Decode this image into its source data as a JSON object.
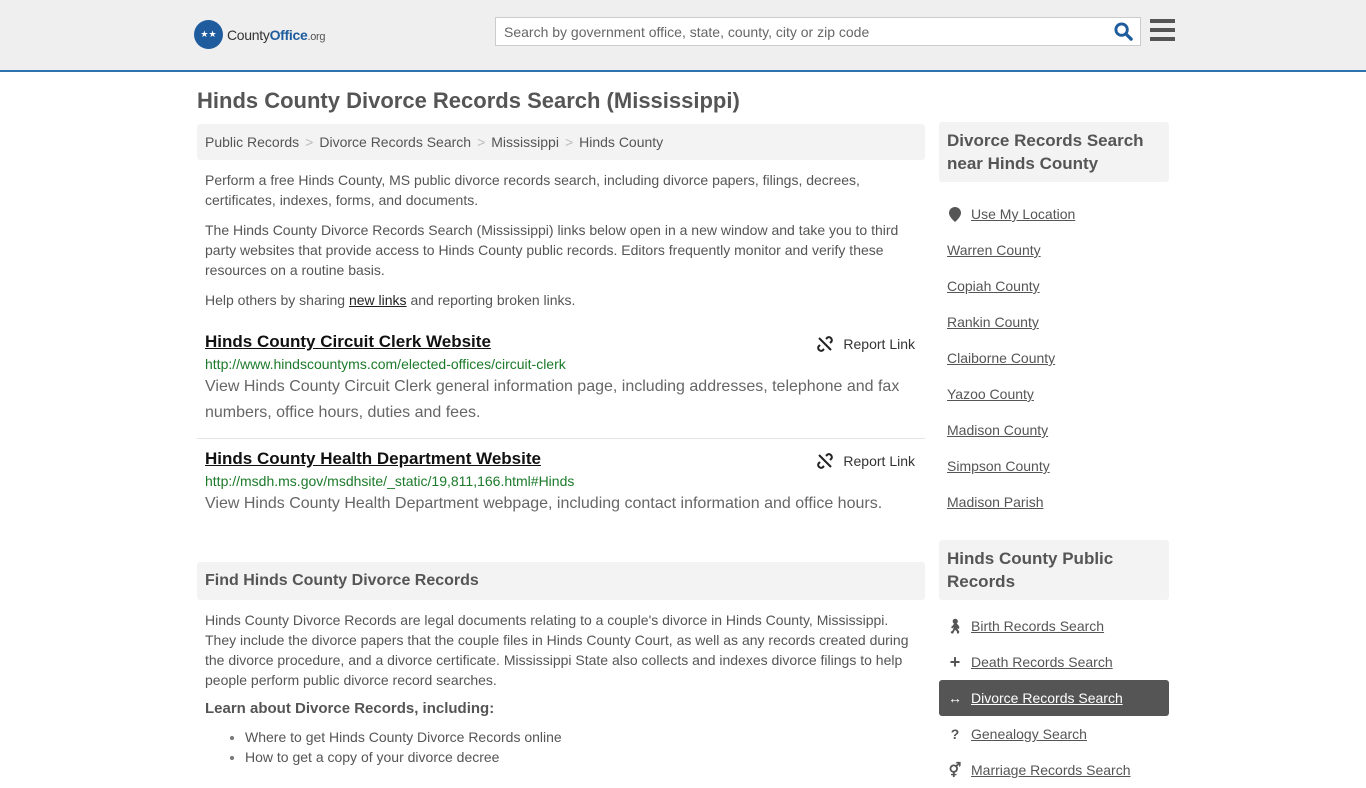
{
  "header": {
    "logo_text_main": "County",
    "logo_text_brand": "Office",
    "logo_text_tld": ".org",
    "search_placeholder": "Search by government office, state, county, city or zip code",
    "search_value": ""
  },
  "page_title": "Hinds County Divorce Records Search (Mississippi)",
  "breadcrumb": [
    "Public Records",
    "Divorce Records Search",
    "Mississippi",
    "Hinds County"
  ],
  "intro": {
    "p1": "Perform a free Hinds County, MS public divorce records search, including divorce papers, filings, decrees, certificates, indexes, forms, and documents.",
    "p2": "The Hinds County Divorce Records Search (Mississippi) links below open in a new window and take you to third party websites that provide access to Hinds County public records. Editors frequently monitor and verify these resources on a routine basis.",
    "p3_before": "Help others by sharing ",
    "p3_link": "new links",
    "p3_after": " and reporting broken links."
  },
  "links": [
    {
      "title": "Hinds County Circuit Clerk Website",
      "url": "http://www.hindscountyms.com/elected-offices/circuit-clerk",
      "description": "View Hinds County Circuit Clerk general information page, including addresses, telephone and fax numbers, office hours, duties and fees.",
      "report_label": "Report Link"
    },
    {
      "title": "Hinds County Health Department Website",
      "url": "http://msdh.ms.gov/msdhsite/_static/19,811,166.html#Hinds",
      "description": "View Hinds County Health Department webpage, including contact information and office hours.",
      "report_label": "Report Link"
    }
  ],
  "find_section": {
    "heading": "Find Hinds County Divorce Records",
    "paragraph": "Hinds County Divorce Records are legal documents relating to a couple's divorce in Hinds County, Mississippi. They include the divorce papers that the couple files in Hinds County Court, as well as any records created during the divorce procedure, and a divorce certificate. Mississippi State also collects and indexes divorce filings to help people perform public divorce record searches.",
    "subheading": "Learn about Divorce Records, including:",
    "bullets": [
      "Where to get Hinds County Divorce Records online",
      "How to get a copy of your divorce decree"
    ]
  },
  "sidebar": {
    "nearby_heading": "Divorce Records Search near Hinds County",
    "use_location": "Use My Location",
    "nearby": [
      "Warren County",
      "Copiah County",
      "Rankin County",
      "Claiborne County",
      "Yazoo County",
      "Madison County",
      "Simpson County",
      "Madison Parish"
    ],
    "public_heading": "Hinds County Public Records",
    "public_records": [
      {
        "label": "Birth Records Search",
        "icon": "child-icon",
        "glyph": "†"
      },
      {
        "label": "Death Records Search",
        "icon": "plus-icon",
        "glyph": "+"
      },
      {
        "label": "Divorce Records Search",
        "icon": "arrows-horizontal-icon",
        "glyph": "↔",
        "active": true
      },
      {
        "label": "Genealogy Search",
        "icon": "question-icon",
        "glyph": "?"
      },
      {
        "label": "Marriage Records Search",
        "icon": "venus-mars-icon",
        "glyph": "⚥"
      }
    ]
  }
}
